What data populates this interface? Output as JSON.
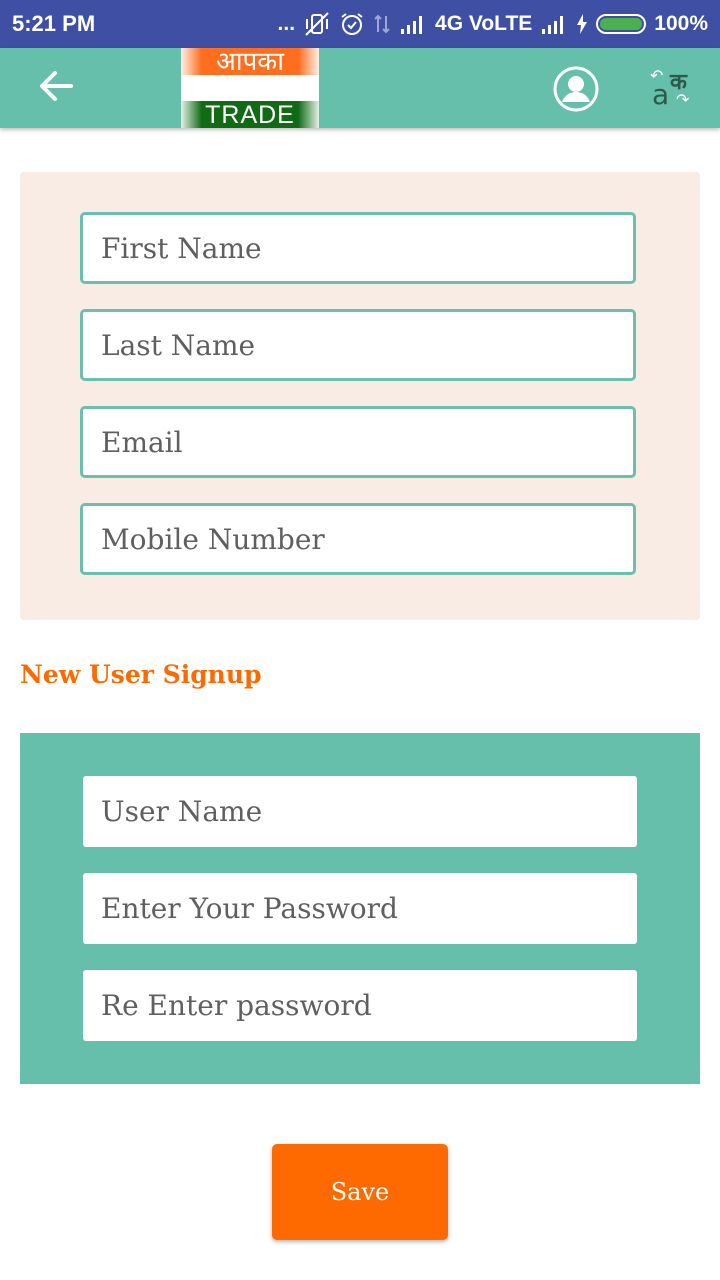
{
  "status_bar": {
    "time": "5:21 PM",
    "dots": "...",
    "network": "4G VoLTE",
    "battery_text": "100%"
  },
  "toolbar": {
    "logo_top_text": "आपका",
    "logo_bottom_text": "TRADE",
    "lang_native_char": "क",
    "lang_latin_char": "a",
    "icons": [
      "back-arrow-icon",
      "profile-icon",
      "language-switch-icon"
    ]
  },
  "personal_form": {
    "first_name_placeholder": "First Name",
    "last_name_placeholder": "Last Name",
    "email_placeholder": "Email",
    "mobile_placeholder": "Mobile Number"
  },
  "signup": {
    "heading": "New User Signup",
    "username_placeholder": "User Name",
    "password_placeholder": "Enter Your Password",
    "reenter_password_placeholder": "Re Enter password"
  },
  "actions": {
    "save_label": "Save"
  },
  "colors": {
    "status_bar": "#3f4fa3",
    "toolbar": "#65bfab",
    "accent_orange": "#ff6a00",
    "panel_beige": "#f8ece4",
    "battery_green": "#4caf50"
  }
}
